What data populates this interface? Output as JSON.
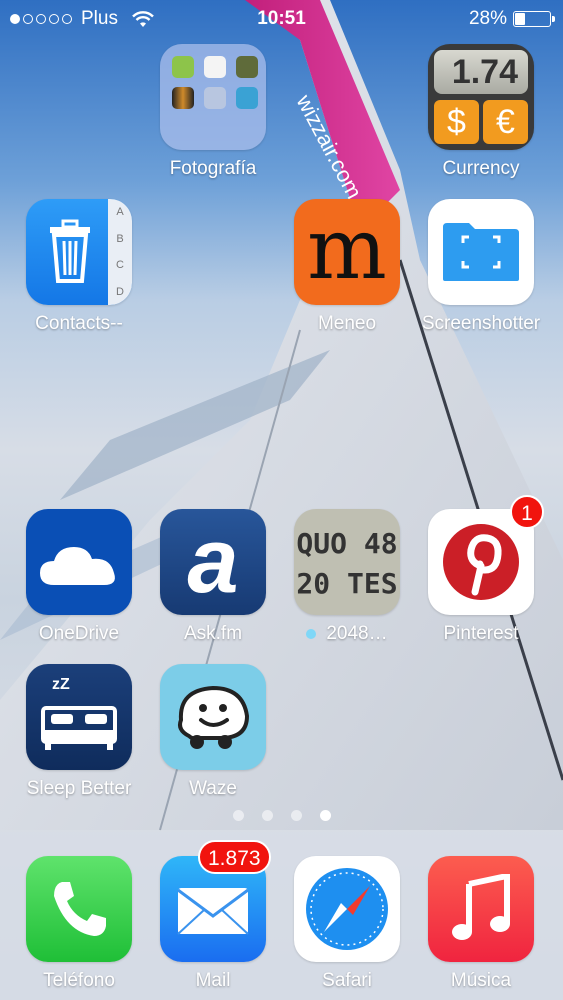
{
  "status_bar": {
    "signal_dots_filled": 1,
    "signal_dots_total": 5,
    "carrier": "Plus",
    "time": "10:51",
    "battery_percent": "28%",
    "battery_level": 0.28
  },
  "apps": {
    "fotografia": {
      "label": "Fotografía"
    },
    "currency": {
      "label": "Currency",
      "value": "1.74",
      "symbol_left": "$",
      "symbol_right": "€"
    },
    "contacts": {
      "label": "Contacts--",
      "tabs": [
        "A",
        "B",
        "C",
        "D"
      ]
    },
    "meneo": {
      "label": "Meneo",
      "glyph": "m"
    },
    "screenshotter": {
      "label": "Screenshotter"
    },
    "onedrive": {
      "label": "OneDrive"
    },
    "askfm": {
      "label": "Ask.fm",
      "glyph": "a"
    },
    "game2048": {
      "label": "2048…",
      "line1": "QUO 48",
      "line2": "20 TES"
    },
    "pinterest": {
      "label": "Pinterest",
      "badge": "1"
    },
    "sleepbetter": {
      "label": "Sleep Better",
      "zz": "zZ"
    },
    "waze": {
      "label": "Waze"
    }
  },
  "wallpaper": {
    "wing_text": "wizzair.com"
  },
  "page_indicator": {
    "count": 4,
    "current": 4
  },
  "dock": {
    "telefono": {
      "label": "Teléfono"
    },
    "mail": {
      "label": "Mail",
      "badge": "1.873"
    },
    "safari": {
      "label": "Safari"
    },
    "musica": {
      "label": "Música"
    }
  },
  "colors": {
    "badge": "#f1140e",
    "meneo": "#f26b1d",
    "pinterest": "#cb1f27",
    "onedrive": "#0a4fb5",
    "waze": "#7ccde8"
  }
}
